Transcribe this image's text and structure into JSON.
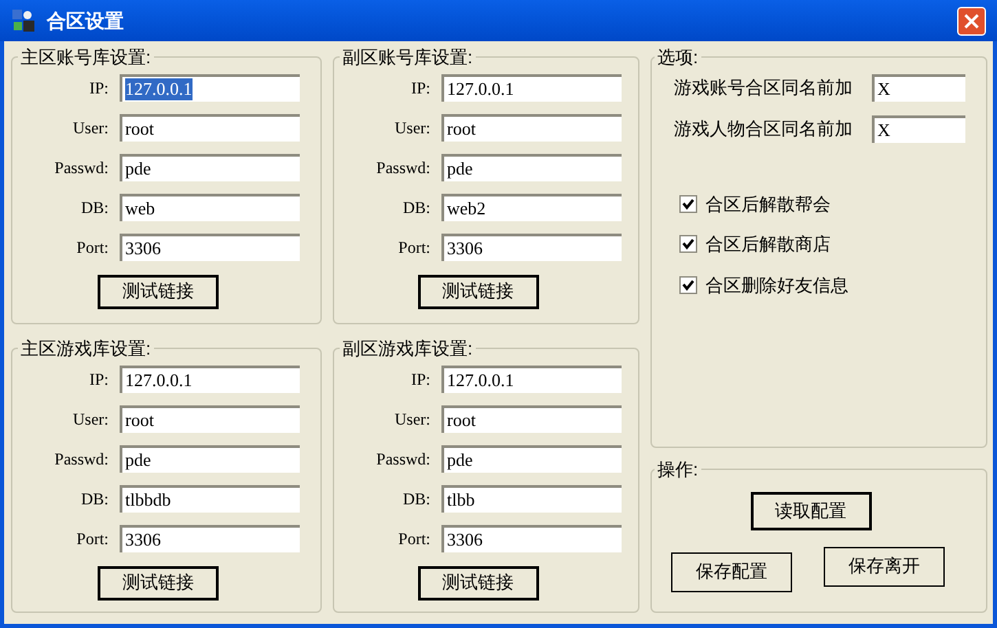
{
  "window": {
    "title": "合区设置"
  },
  "db_groups": [
    {
      "title": "主区账号库设置:",
      "fields": [
        {
          "label": "IP:",
          "value": "127.0.0.1",
          "highlighted": true
        },
        {
          "label": "User:",
          "value": "root",
          "highlighted": false
        },
        {
          "label": "Passwd:",
          "value": "pde",
          "highlighted": false
        },
        {
          "label": "DB:",
          "value": "web",
          "highlighted": false
        },
        {
          "label": "Port:",
          "value": "3306",
          "highlighted": false
        }
      ],
      "button": {
        "label": "测试链接",
        "default": true
      }
    },
    {
      "title": "主区游戏库设置:",
      "fields": [
        {
          "label": "IP:",
          "value": "127.0.0.1",
          "highlighted": false
        },
        {
          "label": "User:",
          "value": "root",
          "highlighted": false
        },
        {
          "label": "Passwd:",
          "value": "pde",
          "highlighted": false
        },
        {
          "label": "DB:",
          "value": "tlbbdb",
          "highlighted": false
        },
        {
          "label": "Port:",
          "value": "3306",
          "highlighted": false
        }
      ],
      "button": {
        "label": "测试链接",
        "default": true
      }
    },
    {
      "title": "副区账号库设置:",
      "fields": [
        {
          "label": "IP:",
          "value": "127.0.0.1",
          "highlighted": false
        },
        {
          "label": "User:",
          "value": "root",
          "highlighted": false
        },
        {
          "label": "Passwd:",
          "value": "pde",
          "highlighted": false
        },
        {
          "label": "DB:",
          "value": "web2",
          "highlighted": false
        },
        {
          "label": "Port:",
          "value": "3306",
          "highlighted": false
        }
      ],
      "button": {
        "label": "测试链接",
        "default": true
      }
    },
    {
      "title": "副区游戏库设置:",
      "fields": [
        {
          "label": "IP:",
          "value": "127.0.0.1",
          "highlighted": false
        },
        {
          "label": "User:",
          "value": "root",
          "highlighted": false
        },
        {
          "label": "Passwd:",
          "value": "pde",
          "highlighted": false
        },
        {
          "label": "DB:",
          "value": "tlbb",
          "highlighted": false
        },
        {
          "label": "Port:",
          "value": "3306",
          "highlighted": false
        }
      ],
      "button": {
        "label": "测试链接",
        "default": true
      }
    }
  ],
  "options": {
    "title": "选项:",
    "prefixes": [
      {
        "label": "游戏账号合区同名前加",
        "value": "X"
      },
      {
        "label": "游戏人物合区同名前加",
        "value": "X"
      }
    ],
    "checkboxes": [
      {
        "label": "合区后解散帮会",
        "checked": true
      },
      {
        "label": "合区后解散商店",
        "checked": true
      },
      {
        "label": "合区删除好友信息",
        "checked": true
      }
    ]
  },
  "actions": {
    "title": "操作:",
    "buttons": [
      {
        "label": "读取配置",
        "default": true
      },
      {
        "label": "保存配置",
        "default": false
      },
      {
        "label": "保存离开",
        "default": false
      }
    ]
  }
}
